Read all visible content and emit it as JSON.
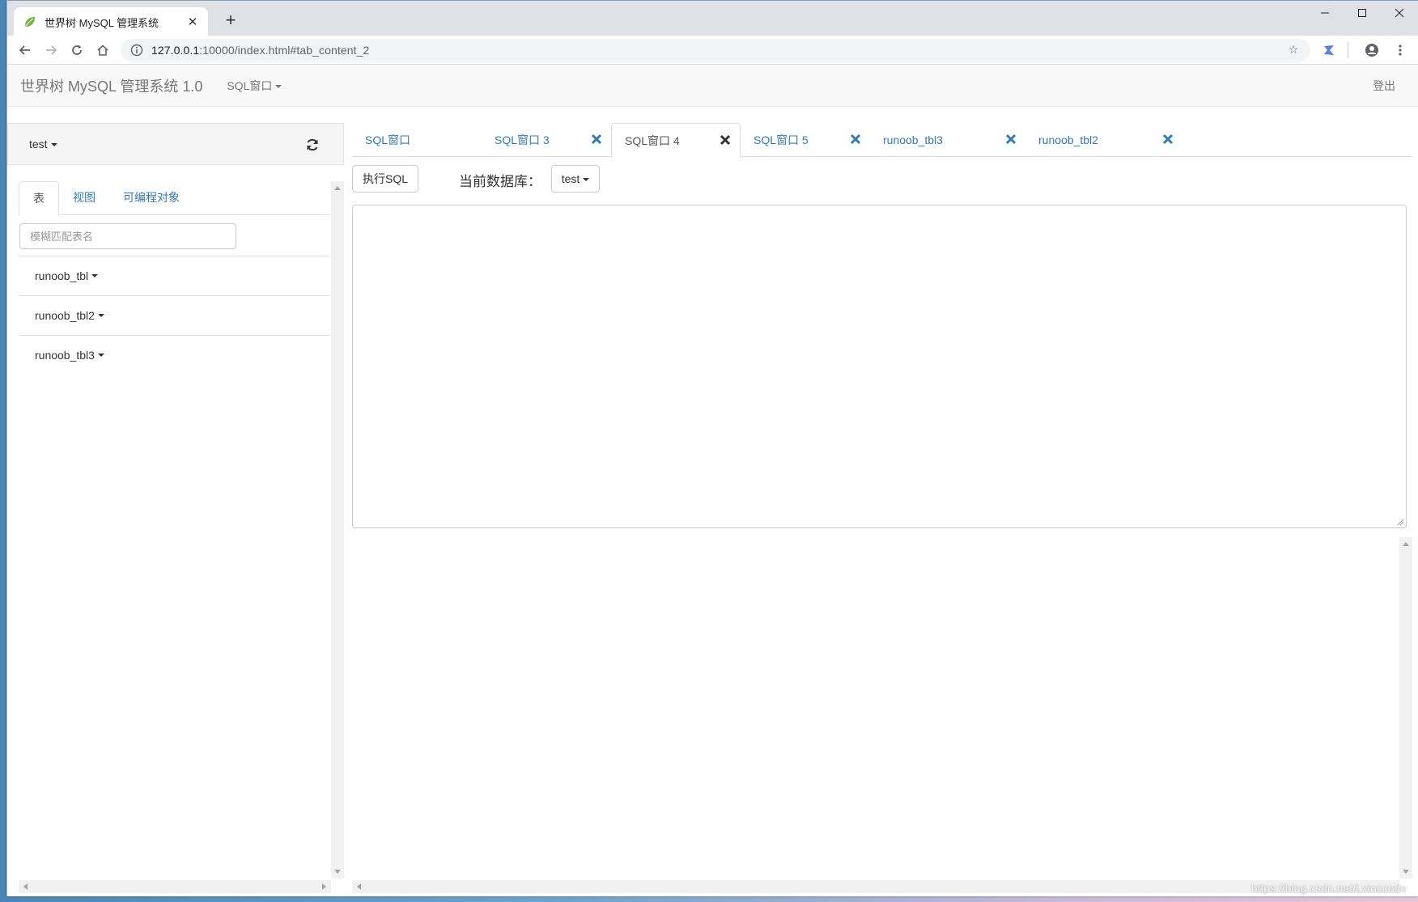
{
  "browser": {
    "tab_title": "世界树 MySQL 管理系统",
    "url_host": "127.0.0.1",
    "url_rest": ":10000/index.html#tab_content_2"
  },
  "navbar": {
    "brand": "世界树 MySQL 管理系统 1.0",
    "sql_menu": "SQL窗口",
    "logout": "登出"
  },
  "sidebar": {
    "database": "test",
    "tabs": [
      {
        "label": "表"
      },
      {
        "label": "视图"
      },
      {
        "label": "可编程对象"
      }
    ],
    "filter_placeholder": "模糊匹配表名",
    "tables": [
      {
        "name": "runoob_tbl"
      },
      {
        "name": "runoob_tbl2"
      },
      {
        "name": "runoob_tbl3"
      }
    ]
  },
  "main": {
    "tabs": [
      {
        "label": "SQL窗口"
      },
      {
        "label": "SQL窗口 3"
      },
      {
        "label": "SQL窗口 4"
      },
      {
        "label": "SQL窗口 5"
      },
      {
        "label": "runoob_tbl3"
      },
      {
        "label": "runoob_tbl2"
      }
    ],
    "execute_label": "执行SQL",
    "current_db_label": "当前数据库：",
    "current_db": "test",
    "sql_text": ""
  },
  "watermark": "https://blog.csdn.net/Lxinccode",
  "colors": {
    "link": "#337ab7",
    "navbar_bg": "#f8f8f8",
    "favicon_green": "#6db33f"
  }
}
